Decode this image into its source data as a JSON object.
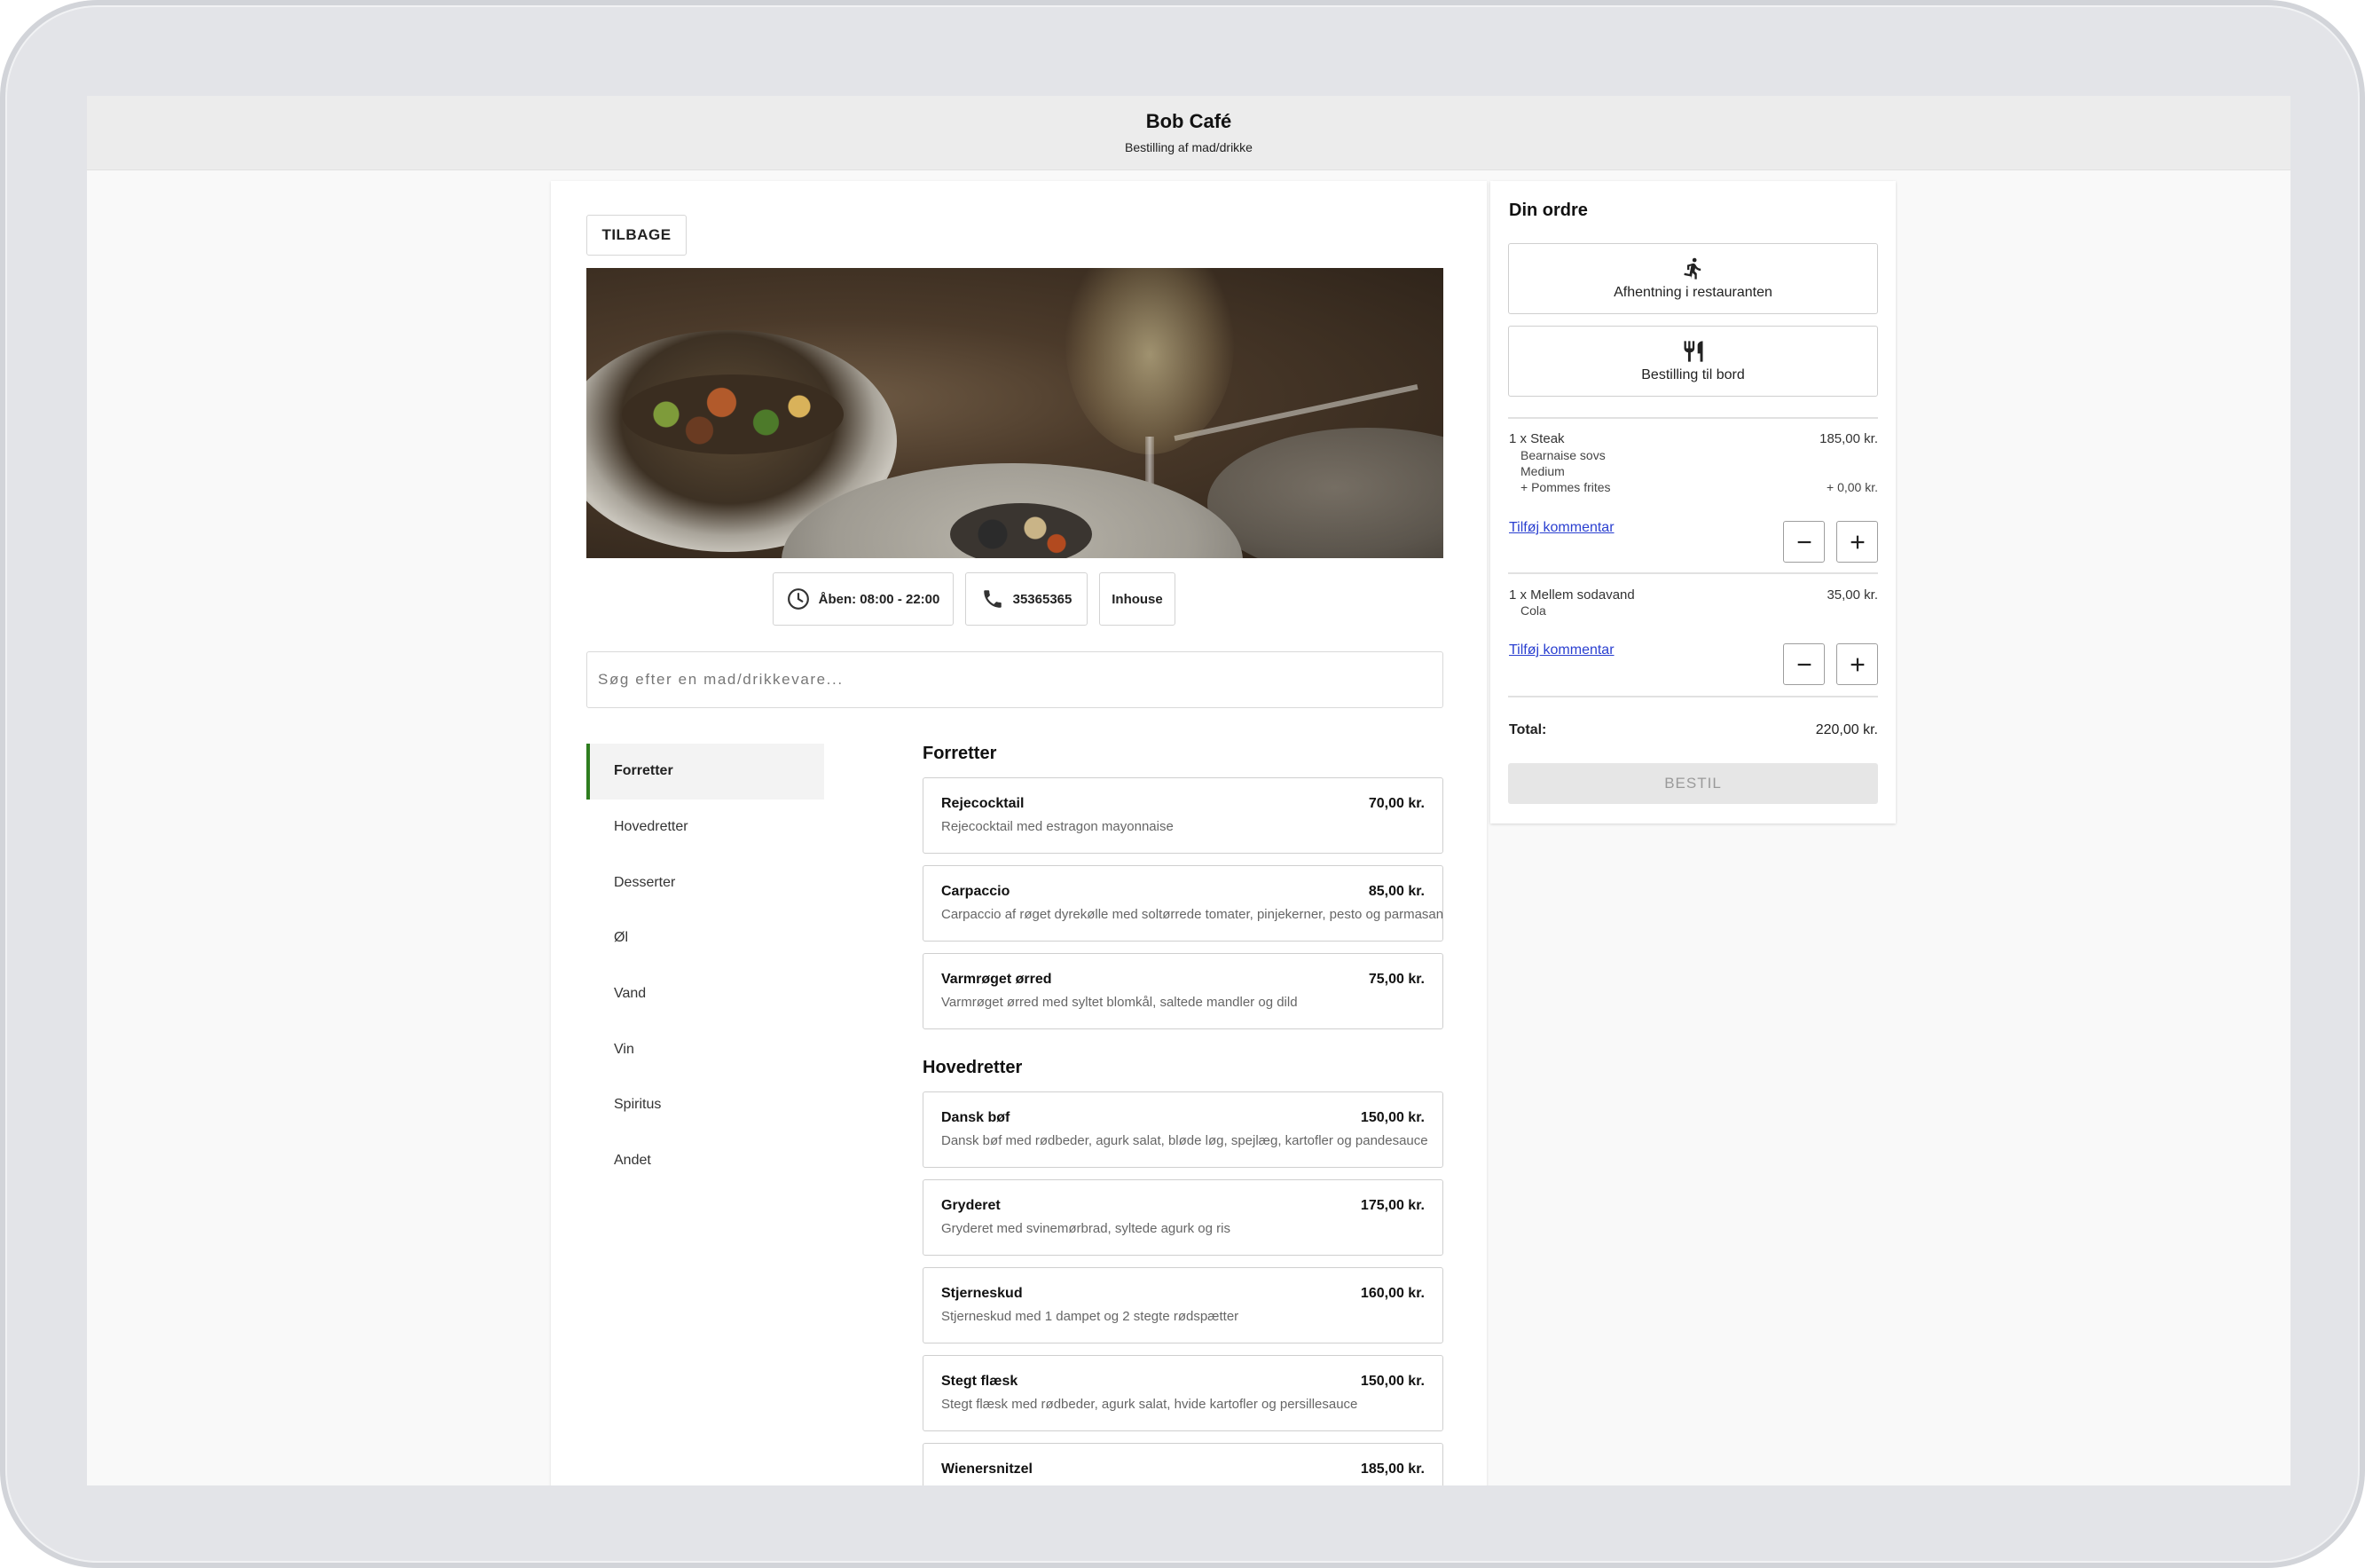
{
  "app": {
    "title": "Bob Café",
    "subtitle": "Bestilling af mad/drikke"
  },
  "main": {
    "back_label": "TILBAGE",
    "info": {
      "hours": "Åben: 08:00 - 22:00",
      "phone": "35365365",
      "mode": "Inhouse"
    },
    "search": {
      "placeholder": "Søg efter en mad/drikkevare..."
    },
    "categories": [
      {
        "label": "Forretter",
        "active": true
      },
      {
        "label": "Hovedretter"
      },
      {
        "label": "Desserter"
      },
      {
        "label": "Øl"
      },
      {
        "label": "Vand"
      },
      {
        "label": "Vin"
      },
      {
        "label": "Spiritus"
      },
      {
        "label": "Andet"
      }
    ],
    "sections": [
      {
        "title": "Forretter",
        "items": [
          {
            "name": "Rejecocktail",
            "price": "70,00 kr.",
            "desc": "Rejecocktail med estragon mayonnaise"
          },
          {
            "name": "Carpaccio",
            "price": "85,00 kr.",
            "desc": "Carpaccio af røget dyrekølle med soltørrede tomater, pinjekerner, pesto og parmasan"
          },
          {
            "name": "Varmrøget ørred",
            "price": "75,00 kr.",
            "desc": "Varmrøget ørred med syltet blomkål, saltede mandler og dild"
          }
        ]
      },
      {
        "title": "Hovedretter",
        "items": [
          {
            "name": "Dansk bøf",
            "price": "150,00 kr.",
            "desc": "Dansk bøf med rødbeder, agurk salat, bløde løg, spejlæg, kartofler og pandesauce"
          },
          {
            "name": "Gryderet",
            "price": "175,00 kr.",
            "desc": "Gryderet med svinemørbrad, syltede agurk og ris"
          },
          {
            "name": "Stjerneskud",
            "price": "160,00 kr.",
            "desc": "Stjerneskud med 1 dampet og 2 stegte rødspætter"
          },
          {
            "name": "Stegt flæsk",
            "price": "150,00 kr.",
            "desc": "Stegt flæsk med rødbeder, agurk salat, hvide kartofler og persillesauce"
          },
          {
            "name": "Wienersnitzel",
            "price": "185,00 kr.",
            "desc": ""
          }
        ]
      }
    ]
  },
  "order": {
    "title": "Din ordre",
    "modes": [
      {
        "label": "Afhentning i restauranten",
        "icon": "walking-person-icon"
      },
      {
        "label": "Bestilling til bord",
        "icon": "fork-knife-icon"
      }
    ],
    "lines": [
      {
        "title": "1 x Steak",
        "price": "185,00 kr.",
        "details": [
          "Bearnaise sovs",
          "Medium",
          "+  Pommes frites"
        ],
        "extra_price": "+ 0,00 kr.",
        "comment_label": "Tilføj kommentar"
      },
      {
        "title": "1 x Mellem sodavand",
        "price": "35,00 kr.",
        "details": [
          "Cola"
        ],
        "comment_label": "Tilføj kommentar"
      }
    ],
    "total_label": "Total:",
    "total_value": "220,00 kr.",
    "order_button": "BESTIL"
  },
  "colors": {
    "accent": "#2e7d1f",
    "link": "#2a3fd0",
    "disabled_bg": "#e6e6e6"
  }
}
